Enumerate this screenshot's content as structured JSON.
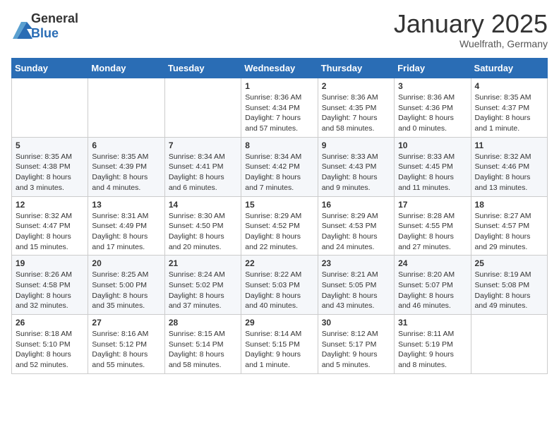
{
  "logo": {
    "general": "General",
    "blue": "Blue"
  },
  "title": "January 2025",
  "location": "Wuelfrath, Germany",
  "weekdays": [
    "Sunday",
    "Monday",
    "Tuesday",
    "Wednesday",
    "Thursday",
    "Friday",
    "Saturday"
  ],
  "weeks": [
    [
      {
        "day": "",
        "info": ""
      },
      {
        "day": "",
        "info": ""
      },
      {
        "day": "",
        "info": ""
      },
      {
        "day": "1",
        "info": "Sunrise: 8:36 AM\nSunset: 4:34 PM\nDaylight: 7 hours and 57 minutes."
      },
      {
        "day": "2",
        "info": "Sunrise: 8:36 AM\nSunset: 4:35 PM\nDaylight: 7 hours and 58 minutes."
      },
      {
        "day": "3",
        "info": "Sunrise: 8:36 AM\nSunset: 4:36 PM\nDaylight: 8 hours and 0 minutes."
      },
      {
        "day": "4",
        "info": "Sunrise: 8:35 AM\nSunset: 4:37 PM\nDaylight: 8 hours and 1 minute."
      }
    ],
    [
      {
        "day": "5",
        "info": "Sunrise: 8:35 AM\nSunset: 4:38 PM\nDaylight: 8 hours and 3 minutes."
      },
      {
        "day": "6",
        "info": "Sunrise: 8:35 AM\nSunset: 4:39 PM\nDaylight: 8 hours and 4 minutes."
      },
      {
        "day": "7",
        "info": "Sunrise: 8:34 AM\nSunset: 4:41 PM\nDaylight: 8 hours and 6 minutes."
      },
      {
        "day": "8",
        "info": "Sunrise: 8:34 AM\nSunset: 4:42 PM\nDaylight: 8 hours and 7 minutes."
      },
      {
        "day": "9",
        "info": "Sunrise: 8:33 AM\nSunset: 4:43 PM\nDaylight: 8 hours and 9 minutes."
      },
      {
        "day": "10",
        "info": "Sunrise: 8:33 AM\nSunset: 4:45 PM\nDaylight: 8 hours and 11 minutes."
      },
      {
        "day": "11",
        "info": "Sunrise: 8:32 AM\nSunset: 4:46 PM\nDaylight: 8 hours and 13 minutes."
      }
    ],
    [
      {
        "day": "12",
        "info": "Sunrise: 8:32 AM\nSunset: 4:47 PM\nDaylight: 8 hours and 15 minutes."
      },
      {
        "day": "13",
        "info": "Sunrise: 8:31 AM\nSunset: 4:49 PM\nDaylight: 8 hours and 17 minutes."
      },
      {
        "day": "14",
        "info": "Sunrise: 8:30 AM\nSunset: 4:50 PM\nDaylight: 8 hours and 20 minutes."
      },
      {
        "day": "15",
        "info": "Sunrise: 8:29 AM\nSunset: 4:52 PM\nDaylight: 8 hours and 22 minutes."
      },
      {
        "day": "16",
        "info": "Sunrise: 8:29 AM\nSunset: 4:53 PM\nDaylight: 8 hours and 24 minutes."
      },
      {
        "day": "17",
        "info": "Sunrise: 8:28 AM\nSunset: 4:55 PM\nDaylight: 8 hours and 27 minutes."
      },
      {
        "day": "18",
        "info": "Sunrise: 8:27 AM\nSunset: 4:57 PM\nDaylight: 8 hours and 29 minutes."
      }
    ],
    [
      {
        "day": "19",
        "info": "Sunrise: 8:26 AM\nSunset: 4:58 PM\nDaylight: 8 hours and 32 minutes."
      },
      {
        "day": "20",
        "info": "Sunrise: 8:25 AM\nSunset: 5:00 PM\nDaylight: 8 hours and 35 minutes."
      },
      {
        "day": "21",
        "info": "Sunrise: 8:24 AM\nSunset: 5:02 PM\nDaylight: 8 hours and 37 minutes."
      },
      {
        "day": "22",
        "info": "Sunrise: 8:22 AM\nSunset: 5:03 PM\nDaylight: 8 hours and 40 minutes."
      },
      {
        "day": "23",
        "info": "Sunrise: 8:21 AM\nSunset: 5:05 PM\nDaylight: 8 hours and 43 minutes."
      },
      {
        "day": "24",
        "info": "Sunrise: 8:20 AM\nSunset: 5:07 PM\nDaylight: 8 hours and 46 minutes."
      },
      {
        "day": "25",
        "info": "Sunrise: 8:19 AM\nSunset: 5:08 PM\nDaylight: 8 hours and 49 minutes."
      }
    ],
    [
      {
        "day": "26",
        "info": "Sunrise: 8:18 AM\nSunset: 5:10 PM\nDaylight: 8 hours and 52 minutes."
      },
      {
        "day": "27",
        "info": "Sunrise: 8:16 AM\nSunset: 5:12 PM\nDaylight: 8 hours and 55 minutes."
      },
      {
        "day": "28",
        "info": "Sunrise: 8:15 AM\nSunset: 5:14 PM\nDaylight: 8 hours and 58 minutes."
      },
      {
        "day": "29",
        "info": "Sunrise: 8:14 AM\nSunset: 5:15 PM\nDaylight: 9 hours and 1 minute."
      },
      {
        "day": "30",
        "info": "Sunrise: 8:12 AM\nSunset: 5:17 PM\nDaylight: 9 hours and 5 minutes."
      },
      {
        "day": "31",
        "info": "Sunrise: 8:11 AM\nSunset: 5:19 PM\nDaylight: 9 hours and 8 minutes."
      },
      {
        "day": "",
        "info": ""
      }
    ]
  ]
}
